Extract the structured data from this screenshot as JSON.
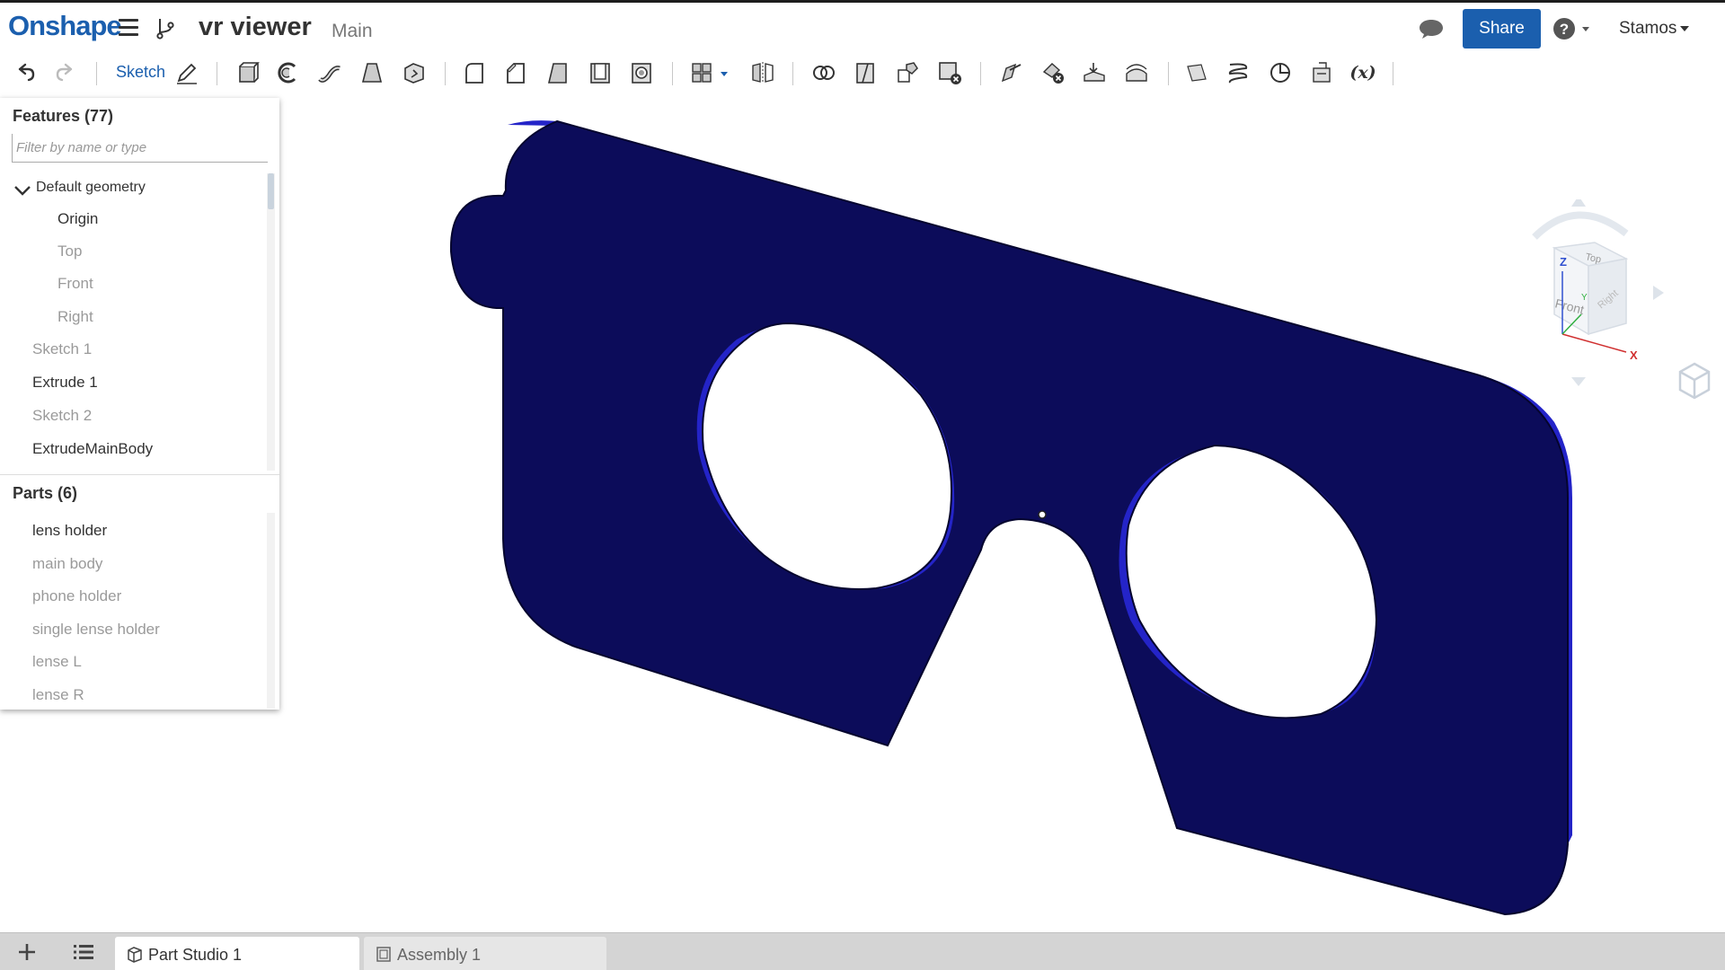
{
  "header": {
    "logo": "Onshape",
    "document_title": "vr viewer",
    "workspace": "Main",
    "share_label": "Share",
    "user_name": "Stamos",
    "icons": [
      "hamburger-menu-icon",
      "branch-icon",
      "chat-icon",
      "help-icon"
    ]
  },
  "toolbar": {
    "sketch_label": "Sketch",
    "tools": [
      "undo-icon",
      "redo-icon",
      "sketch-pencil-icon",
      "extrude-icon",
      "revolve-icon",
      "sweep-icon",
      "loft-icon",
      "thicken-icon",
      "fillet-icon",
      "chamfer-icon",
      "draft-icon",
      "shell-icon",
      "hole-icon",
      "pattern-icon",
      "mirror-icon",
      "boolean-icon",
      "split-icon",
      "transform-icon",
      "delete-part-icon",
      "move-face-icon",
      "delete-face-icon",
      "replace-face-icon",
      "offset-surface-icon",
      "plane-icon",
      "helix-icon",
      "mate-connector-icon",
      "import-icon",
      "variable-icon"
    ]
  },
  "features_panel": {
    "title": "Features (77)",
    "filter_placeholder": "Filter by name or type",
    "group": "Default geometry",
    "items": [
      {
        "label": "Origin",
        "state": "active"
      },
      {
        "label": "Top",
        "state": "dim"
      },
      {
        "label": "Front",
        "state": "dim"
      },
      {
        "label": "Right",
        "state": "dim"
      },
      {
        "label": "Sketch 1",
        "state": "dim"
      },
      {
        "label": "Extrude 1",
        "state": "active"
      },
      {
        "label": "Sketch 2",
        "state": "dim"
      },
      {
        "label": "ExtrudeMainBody",
        "state": "active"
      }
    ]
  },
  "parts_panel": {
    "title": "Parts (6)",
    "items": [
      {
        "label": "lens holder",
        "state": "active"
      },
      {
        "label": "main body",
        "state": "dim"
      },
      {
        "label": "phone holder",
        "state": "dim"
      },
      {
        "label": "single lense holder",
        "state": "dim"
      },
      {
        "label": "lense L",
        "state": "dim"
      },
      {
        "label": "lense R",
        "state": "dim"
      }
    ]
  },
  "view_cube": {
    "faces": {
      "top": "Top",
      "front": "Front",
      "right": "Right"
    },
    "axes": {
      "z": "Z",
      "y": "Y",
      "x": "X"
    }
  },
  "tabs": [
    {
      "label": "Part Studio 1",
      "active": true,
      "icon": "part-studio-icon"
    },
    {
      "label": "Assembly 1",
      "active": false,
      "icon": "assembly-icon"
    }
  ],
  "colors": {
    "brand": "#1b5fae",
    "part_fill": "#0c0c5a",
    "part_edge": "#1f1fbf"
  }
}
